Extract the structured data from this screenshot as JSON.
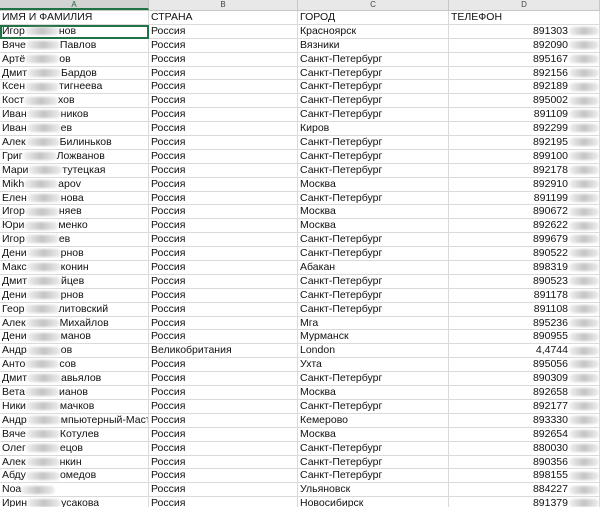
{
  "column_letters": [
    "A",
    "B",
    "C",
    "D"
  ],
  "headers": [
    "ИМЯ И ФАМИЛИЯ",
    "СТРАНА",
    "ГОРОД",
    "ТЕЛЕФОН"
  ],
  "rows": [
    {
      "name_pre": "Игор",
      "name_post": "нов",
      "country": "Россия",
      "city": "Красноярск",
      "phone": "891303"
    },
    {
      "name_pre": "Вяче",
      "name_post": "Павлов",
      "country": "Россия",
      "city": "Вязники",
      "phone": "892090"
    },
    {
      "name_pre": "Артё",
      "name_post": "ов",
      "country": "Россия",
      "city": "Санкт-Петербург",
      "phone": "895167"
    },
    {
      "name_pre": "Дмит",
      "name_post": "Бардов",
      "country": "Россия",
      "city": "Санкт-Петербург",
      "phone": "892156"
    },
    {
      "name_pre": "Ксен",
      "name_post": "тигнеева",
      "country": "Россия",
      "city": "Санкт-Петербург",
      "phone": "892189"
    },
    {
      "name_pre": "Кост",
      "name_post": "хов",
      "country": "Россия",
      "city": "Санкт-Петербург",
      "phone": "895002"
    },
    {
      "name_pre": "Иван",
      "name_post": "ников",
      "country": "Россия",
      "city": "Санкт-Петербург",
      "phone": "891109"
    },
    {
      "name_pre": "Иван",
      "name_post": "ев",
      "country": "Россия",
      "city": "Киров",
      "phone": "892299"
    },
    {
      "name_pre": "Алек",
      "name_post": "Билиньков",
      "country": "Россия",
      "city": "Санкт-Петербург",
      "phone": "892195"
    },
    {
      "name_pre": "Григ",
      "name_post": "Ложванов",
      "country": "Россия",
      "city": "Санкт-Петербург",
      "phone": "899100"
    },
    {
      "name_pre": "Мари",
      "name_post": "тутецкая",
      "country": "Россия",
      "city": "Санкт-Петербург",
      "phone": "892178"
    },
    {
      "name_pre": "Mikh",
      "name_post": "apov",
      "country": "Россия",
      "city": "Москва",
      "phone": "892910"
    },
    {
      "name_pre": "Елен",
      "name_post": "нова",
      "country": "Россия",
      "city": "Санкт-Петербург",
      "phone": "891199"
    },
    {
      "name_pre": "Игор",
      "name_post": "няев",
      "country": "Россия",
      "city": "Москва",
      "phone": "890672"
    },
    {
      "name_pre": "Юри",
      "name_post": "менко",
      "country": "Россия",
      "city": "Москва",
      "phone": "892622"
    },
    {
      "name_pre": "Игор",
      "name_post": "ев",
      "country": "Россия",
      "city": "Санкт-Петербург",
      "phone": "899679"
    },
    {
      "name_pre": "Дени",
      "name_post": "рнов",
      "country": "Россия",
      "city": "Санкт-Петербург",
      "phone": "890522"
    },
    {
      "name_pre": "Макс",
      "name_post": "конин",
      "country": "Россия",
      "city": "Абакан",
      "phone": "898319"
    },
    {
      "name_pre": "Дмит",
      "name_post": "йцев",
      "country": "Россия",
      "city": "Санкт-Петербург",
      "phone": "890523"
    },
    {
      "name_pre": "Дени",
      "name_post": "рнов",
      "country": "Россия",
      "city": "Санкт-Петербург",
      "phone": "891178"
    },
    {
      "name_pre": "Геор",
      "name_post": "литовский",
      "country": "Россия",
      "city": "Санкт-Петербург",
      "phone": "891108"
    },
    {
      "name_pre": "Алек",
      "name_post": "Михайлов",
      "country": "Россия",
      "city": "Мга",
      "phone": "895236"
    },
    {
      "name_pre": "Дени",
      "name_post": "манов",
      "country": "Россия",
      "city": "Мурманск",
      "phone": "890955"
    },
    {
      "name_pre": "Андр",
      "name_post": "ов",
      "country": "Великобритания",
      "city": "London",
      "phone": "4,4744"
    },
    {
      "name_pre": "Анто",
      "name_post": "сов",
      "country": "Россия",
      "city": "Ухта",
      "phone": "895056"
    },
    {
      "name_pre": "Дмит",
      "name_post": "авьялов",
      "country": "Россия",
      "city": "Санкт-Петербург",
      "phone": "890309"
    },
    {
      "name_pre": "Вета",
      "name_post": "ианов",
      "country": "Россия",
      "city": "Москва",
      "phone": "892658"
    },
    {
      "name_pre": "Ники",
      "name_post": "мачков",
      "country": "Россия",
      "city": "Санкт-Петербург",
      "phone": "892177"
    },
    {
      "name_pre": "Андр",
      "name_post": "мпьютерный-Мастер",
      "country": "Россия",
      "city": "Кемерово",
      "phone": "893330"
    },
    {
      "name_pre": "Вяче",
      "name_post": "Котулев",
      "country": "Россия",
      "city": "Москва",
      "phone": "892654"
    },
    {
      "name_pre": "Олег",
      "name_post": "ецов",
      "country": "Россия",
      "city": "Санкт-Петербург",
      "phone": "880030"
    },
    {
      "name_pre": "Алек",
      "name_post": "нкин",
      "country": "Россия",
      "city": "Санкт-Петербург",
      "phone": "890356"
    },
    {
      "name_pre": "Абду",
      "name_post": "омедов",
      "country": "Россия",
      "city": "Санкт-Петербург",
      "phone": "898155"
    },
    {
      "name_pre": "Noa",
      "name_post": "",
      "country": "Россия",
      "city": "Ульяновск",
      "phone": "884227"
    },
    {
      "name_pre": "Ирин",
      "name_post": "усакова",
      "country": "Россия",
      "city": "Новосибирск",
      "phone": "891379"
    }
  ]
}
